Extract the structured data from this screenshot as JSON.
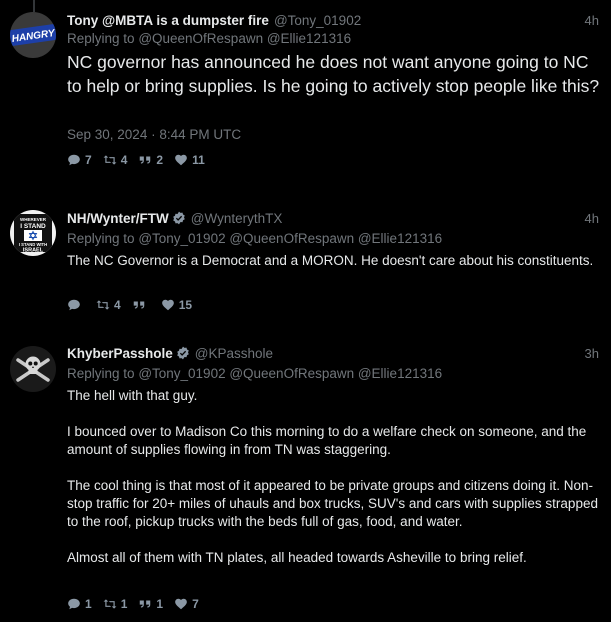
{
  "posts": [
    {
      "display_name": "Tony @MBTA is a dumpster fire",
      "handle": "@Tony_01902",
      "time": "4h",
      "avatar_text": "HANGRY",
      "reply_prefix": "Replying to",
      "mentions": "@QueenOfRespawn @Ellie121316",
      "text": "NC governor has announced he does not want anyone going to NC to help or bring supplies. Is he going to actively stop people like this?",
      "timestamp": "Sep 30, 2024 · 8:44 PM UTC",
      "comments": "7",
      "retweets": "4",
      "quotes": "2",
      "likes": "11"
    },
    {
      "display_name": "NH/Wynter/FTW",
      "handle": "@WynterythTX",
      "time": "4h",
      "avatar_text_lines": [
        "WHEREVER",
        "I STAND",
        "I STAND WITH",
        "ISRAEL"
      ],
      "reply_prefix": "Replying to",
      "mentions": "@Tony_01902 @QueenOfRespawn @Ellie121316",
      "text": "The NC Governor is a Democrat and a MORON. He doesn't care about his constituents.",
      "comments": "",
      "retweets": "4",
      "quotes": "",
      "likes": "15"
    },
    {
      "display_name": "KhyberPasshole",
      "handle": "@KPasshole",
      "time": "3h",
      "reply_prefix": "Replying to",
      "mentions": "@Tony_01902 @QueenOfRespawn @Ellie121316",
      "paragraphs": [
        "The hell with that guy.",
        "I bounced over to Madison Co this morning to do a welfare check on someone, and the amount of supplies flowing in from TN was staggering.",
        "The cool thing is that most of it appeared to be private groups and citizens doing it. Non-stop traffic for 20+ miles of uhauls and box trucks, SUV's and cars with supplies strapped to the roof, pickup trucks with the beds full of gas, food, and water.",
        "Almost all of them with TN plates, all headed towards Asheville to bring relief."
      ],
      "comments": "1",
      "retweets": "1",
      "quotes": "1",
      "likes": "7"
    }
  ],
  "icons": {
    "comment": "comment-icon",
    "retweet": "retweet-icon",
    "quote": "quote-icon",
    "like": "heart-icon",
    "verified": "verified-badge-icon"
  },
  "colors": {
    "background": "#000000",
    "text": "#e7e9ea",
    "muted": "#71767b",
    "verified": "#8b98a5"
  }
}
